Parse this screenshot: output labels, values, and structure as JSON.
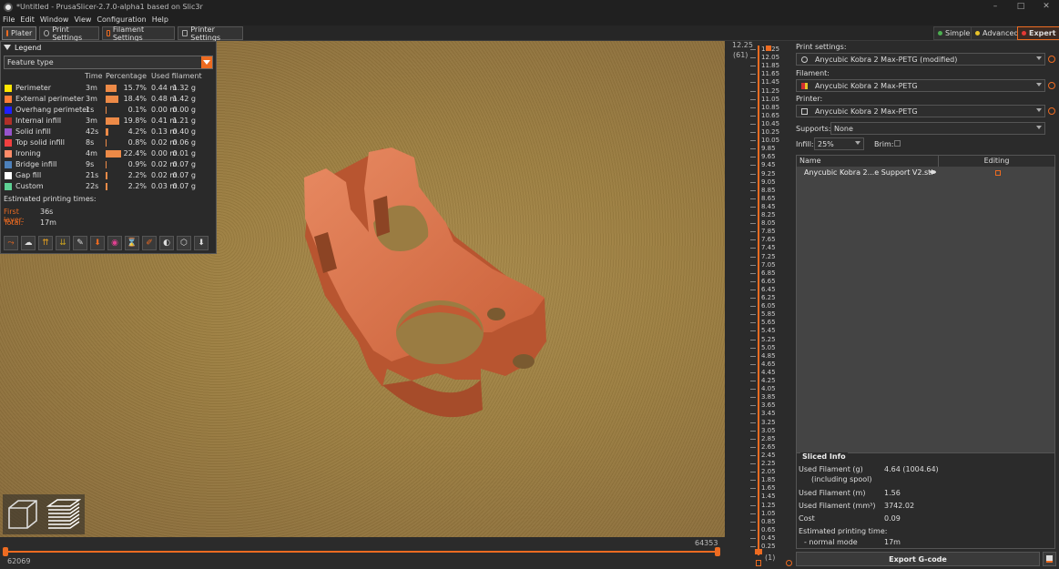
{
  "window": {
    "title": "*Untitled - PrusaSlicer-2.7.0-alpha1 based on Slic3r",
    "controls": [
      "–",
      "□",
      "✕"
    ]
  },
  "menu": [
    "File",
    "Edit",
    "Window",
    "View",
    "Configuration",
    "Help"
  ],
  "tabs": [
    {
      "label": "Plater",
      "active": true
    },
    {
      "label": "Print Settings",
      "active": false
    },
    {
      "label": "Filament Settings",
      "active": false
    },
    {
      "label": "Printer Settings",
      "active": false
    }
  ],
  "modes": [
    {
      "label": "Simple",
      "color": "#4caf50"
    },
    {
      "label": "Advanced",
      "color": "#e6c229"
    },
    {
      "label": "Expert",
      "color": "#e53935"
    }
  ],
  "legend": {
    "title": "Legend",
    "view_type": "Feature type",
    "columns": {
      "time": "Time",
      "percentage": "Percentage",
      "filament": "Used filament"
    },
    "rows": [
      {
        "name": "Perimeter",
        "color": "#ffe600",
        "time": "3m",
        "pct": "15.7%",
        "pct_value": 15.7,
        "len": "0.44 m",
        "weight": "1.32 g"
      },
      {
        "name": "External perimeter",
        "color": "#ff7d38",
        "time": "3m",
        "pct": "18.4%",
        "pct_value": 18.4,
        "len": "0.48 m",
        "weight": "1.42 g"
      },
      {
        "name": "Overhang perimeter",
        "color": "#1f1fff",
        "time": "1s",
        "pct": "0.1%",
        "pct_value": 0.1,
        "len": "0.00 m",
        "weight": "0.00 g"
      },
      {
        "name": "Internal infill",
        "color": "#b03029",
        "time": "3m",
        "pct": "19.8%",
        "pct_value": 19.8,
        "len": "0.41 m",
        "weight": "1.21 g"
      },
      {
        "name": "Solid infill",
        "color": "#9654cc",
        "time": "42s",
        "pct": "4.2%",
        "pct_value": 4.2,
        "len": "0.13 m",
        "weight": "0.40 g"
      },
      {
        "name": "Top solid infill",
        "color": "#f04040",
        "time": "8s",
        "pct": "0.8%",
        "pct_value": 0.8,
        "len": "0.02 m",
        "weight": "0.06 g"
      },
      {
        "name": "Ironing",
        "color": "#ff8c69",
        "time": "4m",
        "pct": "22.4%",
        "pct_value": 22.4,
        "len": "0.00 m",
        "weight": "0.01 g"
      },
      {
        "name": "Bridge infill",
        "color": "#4d80ba",
        "time": "9s",
        "pct": "0.9%",
        "pct_value": 0.9,
        "len": "0.02 m",
        "weight": "0.07 g"
      },
      {
        "name": "Gap fill",
        "color": "#ffffff",
        "time": "21s",
        "pct": "2.2%",
        "pct_value": 2.2,
        "len": "0.02 m",
        "weight": "0.07 g"
      },
      {
        "name": "Custom",
        "color": "#5ed194",
        "time": "22s",
        "pct": "2.2%",
        "pct_value": 2.2,
        "len": "0.03 m",
        "weight": "0.07 g"
      }
    ],
    "estimated_label": "Estimated printing times:",
    "first_layer_label": "First layer:",
    "first_layer_value": "36s",
    "total_label": "Total:",
    "total_value": "17m",
    "tool_icons": [
      "travel-icon",
      "wipe-icon",
      "retractions-icon",
      "deretractions-icon",
      "seams-icon",
      "tool-changes-icon",
      "color-changes-icon",
      "pause-prints-icon",
      "custom-gcode-icon",
      "center-of-gravity-icon",
      "shells-icon",
      "tool-marker-icon"
    ]
  },
  "hslider": {
    "left_value": "62069",
    "right_value": "64353"
  },
  "vslider": {
    "top_value": "12.25",
    "top_layer": "(61)",
    "bottom_value": "(1)",
    "labels": [
      "12.25",
      "12.05",
      "11.85",
      "11.65",
      "11.45",
      "11.25",
      "11.05",
      "10.85",
      "10.65",
      "10.45",
      "10.25",
      "10.05",
      "9.85",
      "9.65",
      "9.45",
      "9.25",
      "9.05",
      "8.85",
      "8.65",
      "8.45",
      "8.25",
      "8.05",
      "7.85",
      "7.65",
      "7.45",
      "7.25",
      "7.05",
      "6.85",
      "6.65",
      "6.45",
      "6.25",
      "6.05",
      "5.85",
      "5.65",
      "5.45",
      "5.25",
      "5.05",
      "4.85",
      "4.65",
      "4.45",
      "4.25",
      "4.05",
      "3.85",
      "3.65",
      "3.45",
      "3.25",
      "3.05",
      "2.85",
      "2.65",
      "2.45",
      "2.25",
      "2.05",
      "1.85",
      "1.65",
      "1.45",
      "1.25",
      "1.05",
      "0.85",
      "0.65",
      "0.45",
      "0.25"
    ]
  },
  "right_panel": {
    "print_settings_label": "Print settings:",
    "print_settings_value": "Anycubic Kobra 2 Max-PETG (modified)",
    "filament_label": "Filament:",
    "filament_value": "Anycubic Kobra 2 Max-PETG",
    "printer_label": "Printer:",
    "printer_value": "Anycubic Kobra 2 Max-PETG",
    "supports_label": "Supports:",
    "supports_value": "None",
    "infill_label": "Infill:",
    "infill_value": "25%",
    "brim_label": "Brim:",
    "object_list": {
      "col_name": "Name",
      "col_editing": "Editing",
      "object_name": "Anycubic Kobra 2...e Support V2.stl"
    },
    "sliced_info": {
      "title": "Sliced Info",
      "filament_g_label": "Used Filament (g)",
      "filament_g_sub": "(including spool)",
      "filament_g_value": "4.64 (1004.64)",
      "filament_m_label": "Used Filament (m)",
      "filament_m_value": "1.56",
      "filament_mm3_label": "Used Filament (mm³)",
      "filament_mm3_value": "3742.02",
      "cost_label": "Cost",
      "cost_value": "0.09",
      "time_label": "Estimated printing time:",
      "mode_label": "- normal mode",
      "mode_value": "17m"
    },
    "export_label": "Export G-code"
  },
  "colors": {
    "accent": "#ed6b21",
    "model": "#d9744f"
  }
}
